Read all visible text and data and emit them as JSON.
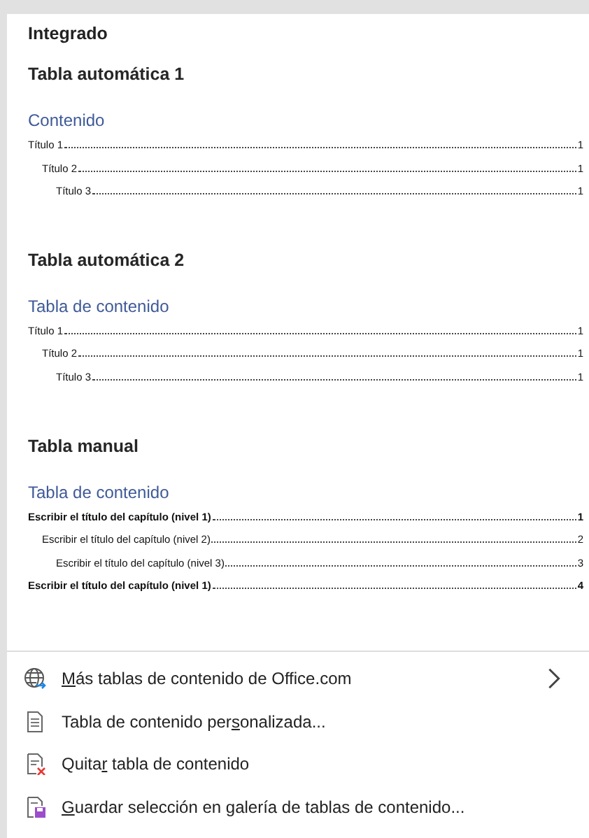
{
  "gallery": {
    "category": "Integrado",
    "sections": [
      {
        "kind": "automatic",
        "title": "Tabla automática 1",
        "toc_heading": "Contenido",
        "entries": [
          {
            "text": "Título 1",
            "page": "1",
            "children": [
              {
                "text": "Título 2",
                "page": "1",
                "children": [
                  {
                    "text": "Título 3",
                    "page": "1"
                  }
                ]
              }
            ]
          }
        ]
      },
      {
        "kind": "automatic",
        "title": "Tabla automática 2",
        "toc_heading": "Tabla de contenido",
        "entries": [
          {
            "text": "Título 1",
            "page": "1",
            "children": [
              {
                "text": "Título 2",
                "page": "1",
                "children": [
                  {
                    "text": "Título 3",
                    "page": "1"
                  }
                ]
              }
            ]
          }
        ]
      },
      {
        "kind": "manual",
        "title": "Tabla manual",
        "toc_heading": "Tabla de contenido",
        "entries": [
          {
            "text": "Escribir el título del capítulo (nivel 1)",
            "page": "1",
            "children": [
              {
                "text": "Escribir el título del capítulo (nivel 2)",
                "page": "2",
                "children": [
                  {
                    "text": "Escribir el título del capítulo (nivel 3)",
                    "page": "3"
                  }
                ]
              }
            ]
          },
          {
            "text": "Escribir el título del capítulo (nivel 1)",
            "page": "4"
          }
        ]
      }
    ]
  },
  "menu": [
    {
      "kind": "web",
      "access_key": "M",
      "after": "ás tablas de contenido de Office.com",
      "submenu": true
    },
    {
      "kind": "custom",
      "before": "Tabla de contenido per",
      "access_key": "s",
      "after": "onalizada...",
      "submenu": false
    },
    {
      "kind": "remove",
      "before": "Quita",
      "access_key": "r",
      "after": " tabla de contenido",
      "submenu": false
    },
    {
      "kind": "save",
      "access_key": "G",
      "after": "uardar selección en galería de tablas de contenido...",
      "submenu": false
    }
  ]
}
